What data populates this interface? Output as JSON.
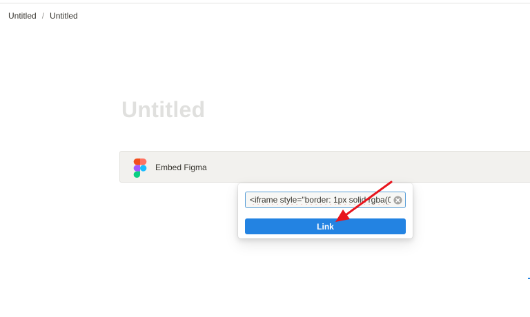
{
  "breadcrumb": {
    "items": [
      "Untitled",
      "Untitled"
    ],
    "separator": "/"
  },
  "page": {
    "title": "Untitled"
  },
  "embed": {
    "label": "Embed Figma",
    "icon": "figma-icon"
  },
  "popup": {
    "input_value": "<iframe style=\"border: 1px solid rgba(0",
    "clear_icon": "clear-circle-icon",
    "button_label": "Link"
  },
  "colors": {
    "accent": "#2383e2",
    "annotation_arrow": "#e8141d",
    "title_placeholder": "#e0e0de",
    "embed_background": "#f2f1ee"
  }
}
